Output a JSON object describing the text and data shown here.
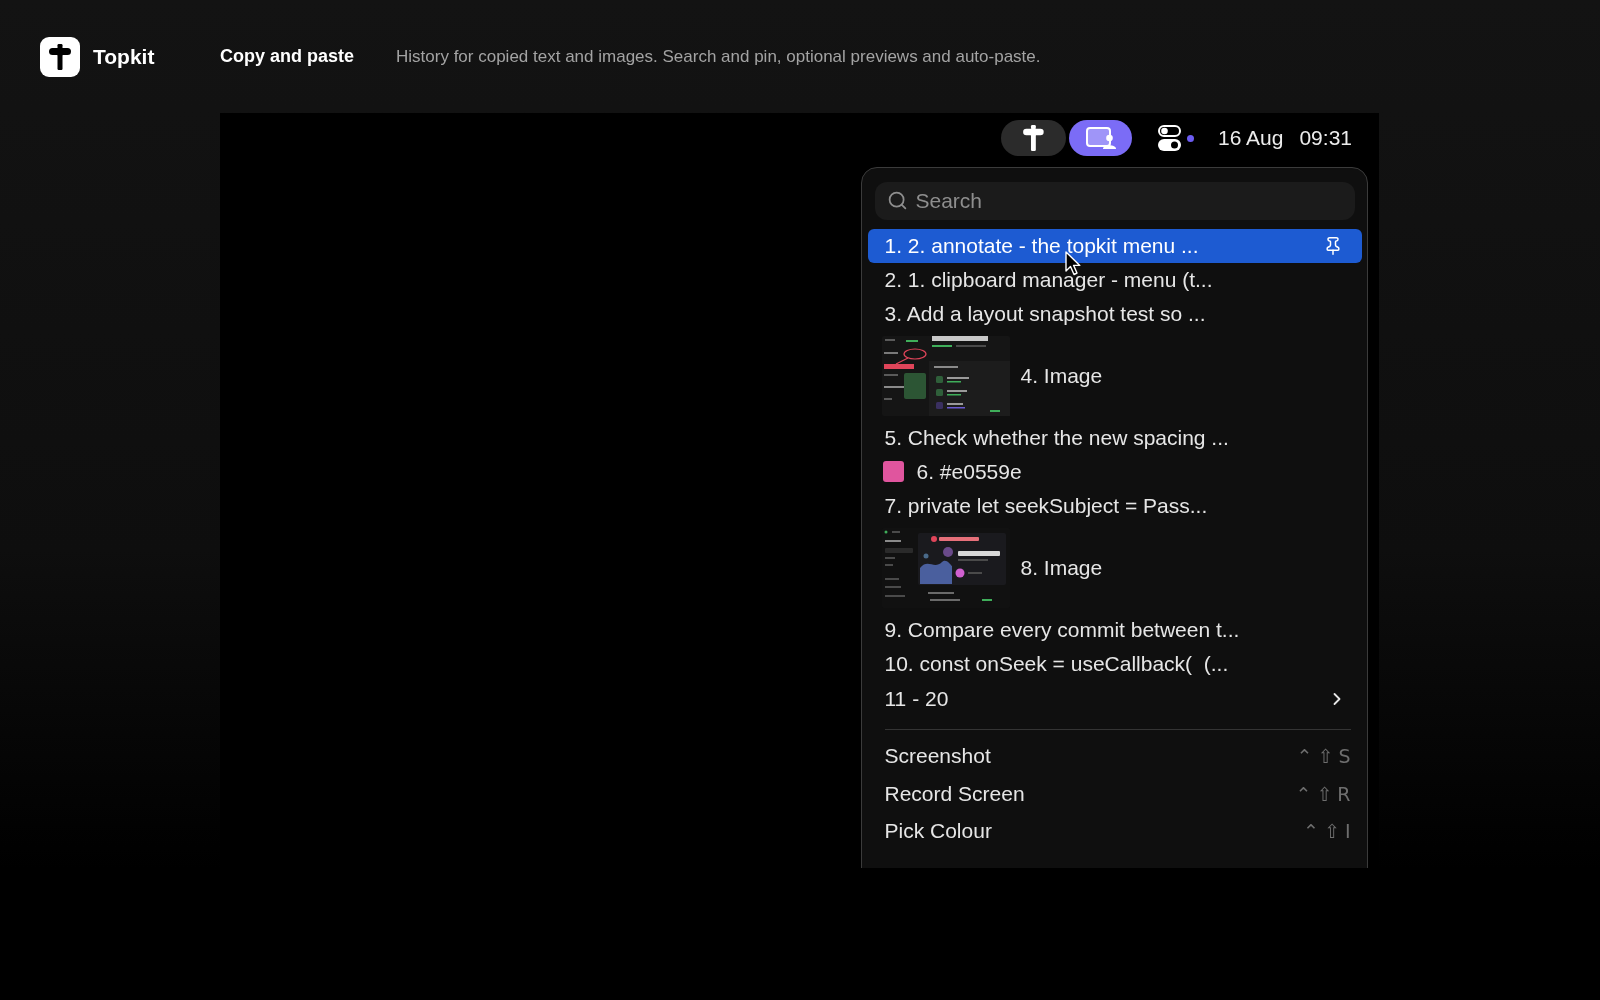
{
  "header": {
    "brand": "Topkit",
    "title": "Copy and paste",
    "description": "History for copied text and images. Search and pin, optional previews and auto-paste."
  },
  "menu_bar": {
    "buttons": [
      {
        "kind": "app",
        "selected": false
      },
      {
        "kind": "capture",
        "selected": true
      }
    ],
    "date": "16 Aug",
    "time": "09:31"
  },
  "menu": {
    "search": {
      "placeholder": "Search"
    },
    "history": [
      {
        "kind": "text",
        "label": "1. 2. annotate - the topkit menu ...",
        "selected": true
      },
      {
        "kind": "text",
        "label": "2. 1. clipboard manager - menu (t...",
        "selected": false
      },
      {
        "kind": "text",
        "label": "3. Add a layout snapshot test so ...",
        "selected": false
      },
      {
        "kind": "image",
        "label": "4. Image",
        "selected": false
      },
      {
        "kind": "text",
        "label": "5. Check whether the new spacing ...",
        "selected": false
      },
      {
        "kind": "color",
        "label": "6. #e0559e",
        "color": "#e0559e",
        "selected": false
      },
      {
        "kind": "text",
        "label": "7. private let seekSubject = Pass...",
        "selected": false
      },
      {
        "kind": "image",
        "label": "8. Image",
        "selected": false
      },
      {
        "kind": "text",
        "label": "9. Compare every commit between t...",
        "selected": false
      },
      {
        "kind": "text",
        "label": "10. const onSeek = useCallback(  (...",
        "selected": false
      }
    ],
    "more": {
      "label": "11 - 20"
    },
    "actions": [
      {
        "label": "Screenshot",
        "keys": [
          "⌃",
          "⇧",
          "S"
        ]
      },
      {
        "label": "Record Screen",
        "keys": [
          "⌃",
          "⇧",
          "R"
        ]
      },
      {
        "label": "Pick Colour",
        "keys": [
          "⌃",
          "⇧",
          "I"
        ]
      }
    ]
  }
}
